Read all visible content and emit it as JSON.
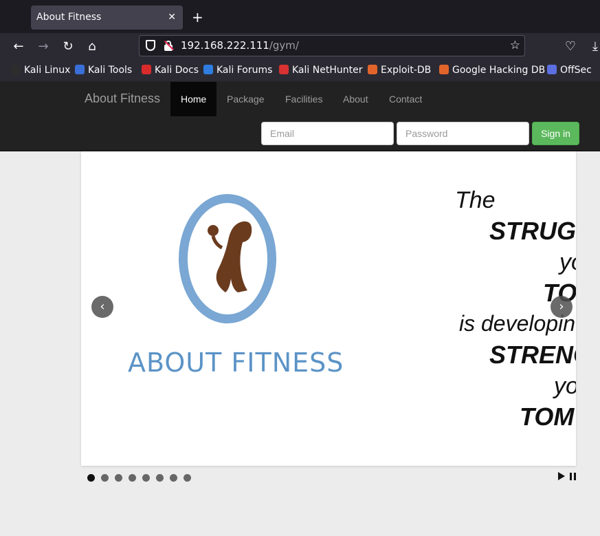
{
  "browser": {
    "tab_title": "About Fitness",
    "tab_close": "✕",
    "new_tab": "+",
    "url_host": "192.168.222.111",
    "url_path": "/gym/",
    "bookmarks": [
      {
        "label": "Kali Linux",
        "icon": "kali-linux-icon",
        "color": "#2d2d2d"
      },
      {
        "label": "Kali Tools",
        "icon": "kali-tools-icon",
        "color": "#3a6fd8"
      },
      {
        "label": "Kali Docs",
        "icon": "kali-docs-icon",
        "color": "#d92b2b"
      },
      {
        "label": "Kali Forums",
        "icon": "kali-forums-icon",
        "color": "#2f7de1"
      },
      {
        "label": "Kali NetHunter",
        "icon": "kali-nethunter-icon",
        "color": "#d83232"
      },
      {
        "label": "Exploit-DB",
        "icon": "exploit-db-icon",
        "color": "#e3642b"
      },
      {
        "label": "Google Hacking DB",
        "icon": "ghdb-icon",
        "color": "#e3642b"
      },
      {
        "label": "OffSec",
        "icon": "offsec-icon",
        "color": "#5b6fe0"
      }
    ]
  },
  "site": {
    "brand": "About Fitness",
    "nav": [
      "Home",
      "Package",
      "Facilities",
      "About",
      "Contact"
    ],
    "active_nav": "Home",
    "email_placeholder": "Email",
    "password_placeholder": "Password",
    "signin_label": "Sign in"
  },
  "slide": {
    "logo_text": "ABOUT FITNESS",
    "quote_lines": [
      "The",
      "STRUG",
      "yo",
      "TO",
      "is developin",
      "STRENG",
      "yo",
      "TOM"
    ]
  },
  "carousel": {
    "prev": "‹",
    "next": "›",
    "dot_count": 8,
    "active_dot": 0
  }
}
